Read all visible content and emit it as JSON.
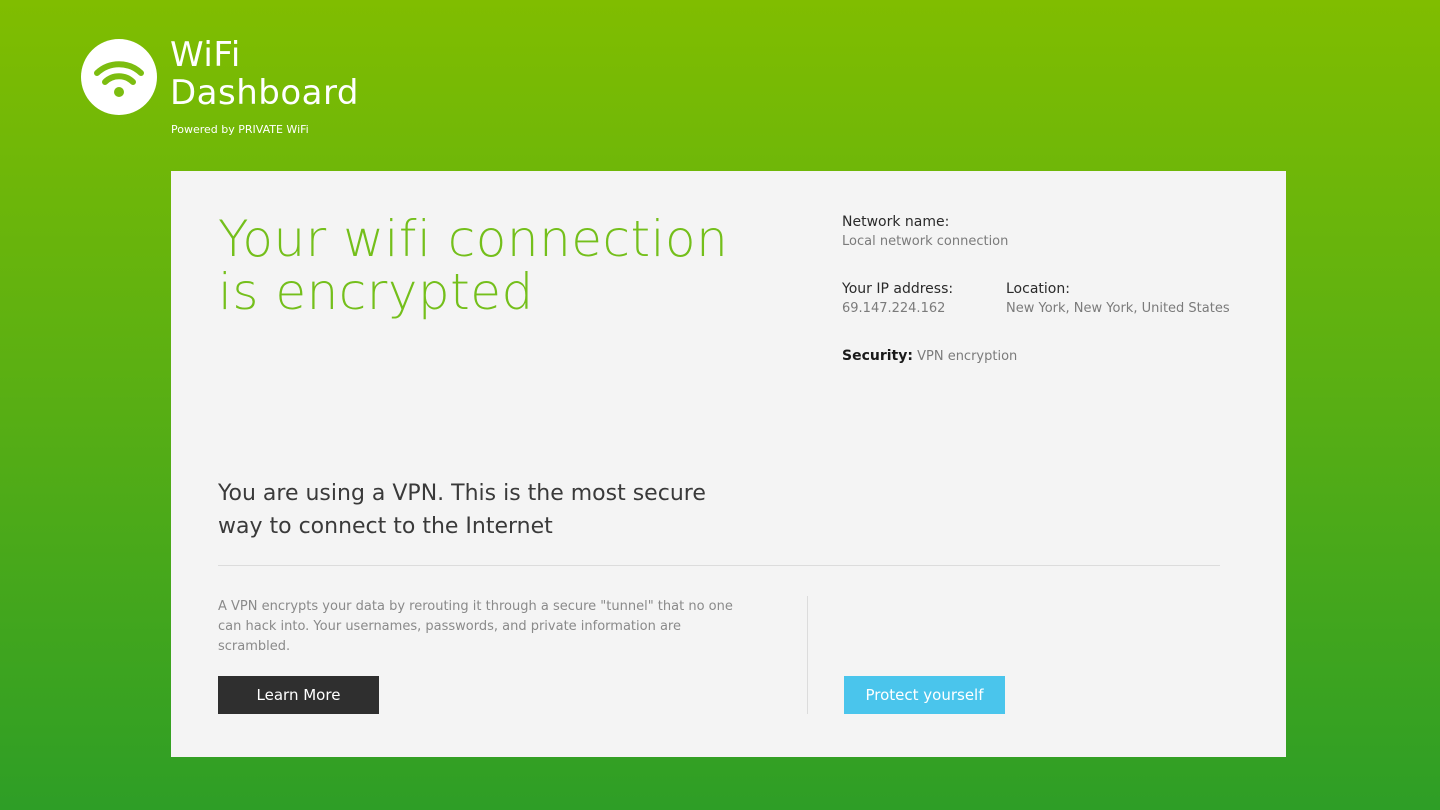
{
  "logo": {
    "title_line1": "WiFi",
    "title_line2": "Dashboard",
    "powered_by": "Powered by PRIVATE WiFi",
    "icon": "wifi-icon"
  },
  "card": {
    "headline_line1": "Your wifi connection",
    "headline_line2": "is encrypted",
    "network_name_label": "Network name:",
    "network_name_value": "Local network connection",
    "ip_label": "Your IP address:",
    "ip_value": "69.147.224.162",
    "location_label": "Location:",
    "location_value": "New York, New York, United States",
    "security_label": "Security:",
    "security_value": "VPN encryption",
    "subhead_line1": "You are using a VPN. This is the most secure",
    "subhead_line2": "way to connect to the Internet",
    "desc_line1": "A VPN encrypts your data by rerouting it through a secure \"tunnel\" that no one",
    "desc_line2": "can hack into. Your usernames, passwords, and private information are",
    "desc_line3": "scrambled.",
    "learn_more_label": "Learn More",
    "protect_label": "Protect yourself"
  },
  "colors": {
    "accent_green": "#74bf1b",
    "background_top": "#80bd00",
    "background_bottom": "#2e9e26",
    "protect_button": "#4ac5ec",
    "learn_button": "#2f2f2f"
  }
}
